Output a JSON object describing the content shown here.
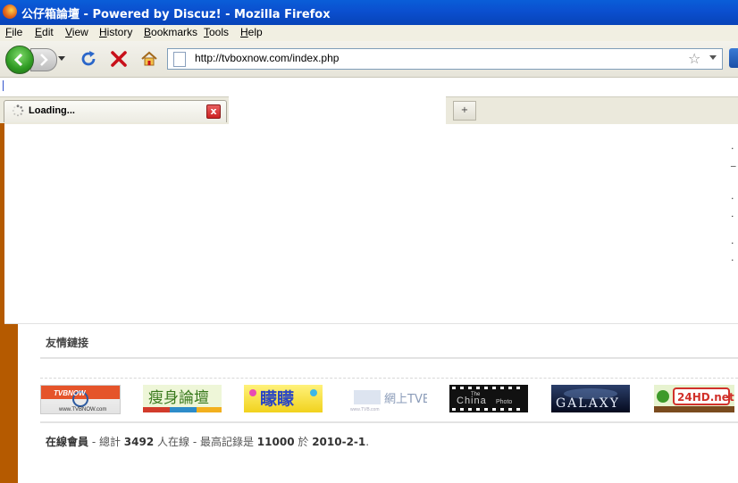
{
  "window": {
    "title": "公仔箱論壇 - Powered by Discuz! - Mozilla Firefox"
  },
  "menu": {
    "items": [
      "File",
      "Edit",
      "View",
      "History",
      "Bookmarks",
      "Tools",
      "Help"
    ]
  },
  "toolbar": {
    "url": "http://tvboxnow.com/index.php",
    "bookmark_icon": "star-icon"
  },
  "tab": {
    "label": "Loading...",
    "close_glyph": "x",
    "new_tab_glyph": "+"
  },
  "page": {
    "links_title": "友情鏈接",
    "logos": [
      {
        "text": "TVBNOW",
        "sub": "www.TVBNOW.com"
      },
      {
        "text": "瘦身論壇"
      },
      {
        "text": "矇矇"
      },
      {
        "text": "網上TVB"
      },
      {
        "text": "The China Photo"
      },
      {
        "text": "GALAXY"
      },
      {
        "text": "24HD.net"
      }
    ],
    "online": {
      "label": "在線會員",
      "sep1": " - 總計 ",
      "count": "3492",
      "mid": " 人在線 - 最高記錄是 ",
      "max": "11000",
      "on": " 於 ",
      "date": "2010-2-1",
      "end": "."
    }
  },
  "colors": {
    "accent_bar": "#b55a00",
    "title_bar": "#0b4fcf"
  }
}
